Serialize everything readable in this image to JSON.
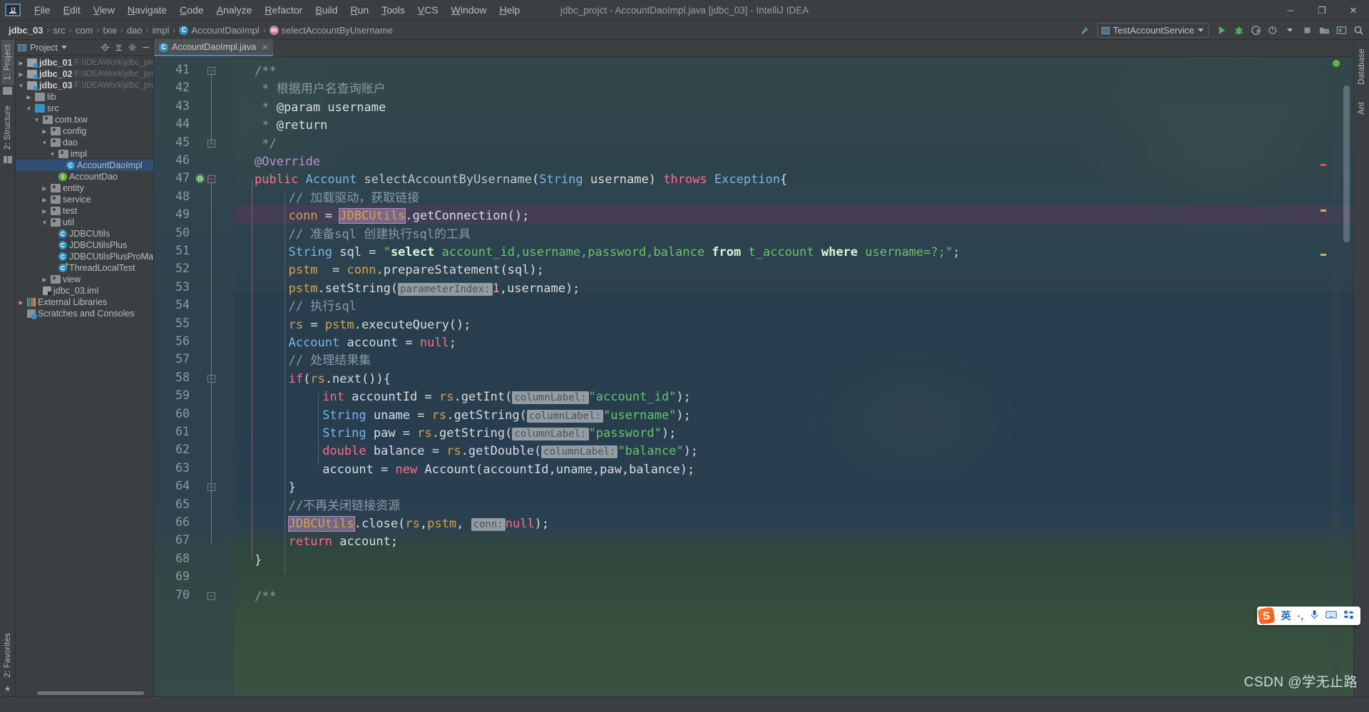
{
  "window": {
    "title": "jdbc_projct - AccountDaoImpl.java [jdbc_03] - IntelliJ IDEA",
    "minimize": "─",
    "maximize": "❐",
    "close": "✕"
  },
  "menu": [
    "File",
    "Edit",
    "View",
    "Navigate",
    "Code",
    "Analyze",
    "Refactor",
    "Build",
    "Run",
    "Tools",
    "VCS",
    "Window",
    "Help"
  ],
  "breadcrumbs": [
    {
      "label": "jdbc_03",
      "kind": "project"
    },
    {
      "label": "src",
      "kind": "folder"
    },
    {
      "label": "com",
      "kind": "folder"
    },
    {
      "label": "txw",
      "kind": "folder"
    },
    {
      "label": "dao",
      "kind": "folder"
    },
    {
      "label": "impl",
      "kind": "folder"
    },
    {
      "label": "AccountDaoImpl",
      "kind": "class"
    },
    {
      "label": "selectAccountByUsername",
      "kind": "method"
    }
  ],
  "toolbar": {
    "run_config": "TestAccountService",
    "icons": [
      "build-icon",
      "run-icon",
      "debug-icon",
      "run-coverage-icon",
      "profiler-icon",
      "stop-icon",
      "project-structure-icon",
      "terminal-icon",
      "search-everywhere-icon"
    ]
  },
  "left_strip": {
    "tabs": [
      "1: Project",
      "2: Structure"
    ],
    "bottom_tabs": [
      "2: Favorites"
    ]
  },
  "right_strip": {
    "tabs": [
      "Database",
      "Ant"
    ]
  },
  "project_panel": {
    "title": "Project",
    "actions": [
      "locate-icon",
      "collapse-all-icon",
      "settings-icon",
      "hide-icon"
    ],
    "tree": [
      {
        "indent": 0,
        "arrow": "collapsed",
        "icon": "module",
        "label": "jdbc_01",
        "bold": true,
        "path": "F:\\IDEAWork\\jdbc_projct\\j"
      },
      {
        "indent": 0,
        "arrow": "collapsed",
        "icon": "module",
        "label": "jdbc_02",
        "bold": true,
        "path": "F:\\IDEAWork\\jdbc_projct\\j"
      },
      {
        "indent": 0,
        "arrow": "expanded",
        "icon": "module",
        "label": "jdbc_03",
        "bold": true,
        "path": "F:\\IDEAWork\\jdbc_projct\\j"
      },
      {
        "indent": 1,
        "arrow": "collapsed",
        "icon": "dir",
        "label": "lib"
      },
      {
        "indent": 1,
        "arrow": "expanded",
        "icon": "src",
        "label": "src"
      },
      {
        "indent": 2,
        "arrow": "expanded",
        "icon": "pkg",
        "label": "com.txw"
      },
      {
        "indent": 3,
        "arrow": "collapsed",
        "icon": "pkg",
        "label": "config"
      },
      {
        "indent": 3,
        "arrow": "expanded",
        "icon": "pkg",
        "label": "dao"
      },
      {
        "indent": 4,
        "arrow": "expanded",
        "icon": "pkg",
        "label": "impl"
      },
      {
        "indent": 5,
        "arrow": "none",
        "icon": "class",
        "label": "AccountDaoImpl",
        "selected": true
      },
      {
        "indent": 4,
        "arrow": "none",
        "icon": "interface",
        "label": "AccountDao"
      },
      {
        "indent": 3,
        "arrow": "collapsed",
        "icon": "pkg",
        "label": "entity"
      },
      {
        "indent": 3,
        "arrow": "collapsed",
        "icon": "pkg",
        "label": "service"
      },
      {
        "indent": 3,
        "arrow": "collapsed",
        "icon": "pkg",
        "label": "test"
      },
      {
        "indent": 3,
        "arrow": "expanded",
        "icon": "pkg",
        "label": "util"
      },
      {
        "indent": 4,
        "arrow": "none",
        "icon": "class",
        "label": "JDBCUtils"
      },
      {
        "indent": 4,
        "arrow": "none",
        "icon": "class",
        "label": "JDBCUtilsPlus"
      },
      {
        "indent": 4,
        "arrow": "none",
        "icon": "class",
        "label": "JDBCUtilsPlusProMax"
      },
      {
        "indent": 4,
        "arrow": "none",
        "icon": "class-runnable",
        "label": "ThreadLocalTest"
      },
      {
        "indent": 3,
        "arrow": "collapsed",
        "icon": "pkg",
        "label": "view"
      },
      {
        "indent": 2,
        "arrow": "none",
        "icon": "iml",
        "label": "jdbc_03.iml"
      },
      {
        "indent": 0,
        "arrow": "collapsed",
        "icon": "libs",
        "label": "External Libraries"
      },
      {
        "indent": 0,
        "arrow": "none",
        "icon": "scratch",
        "label": "Scratches and Consoles"
      }
    ]
  },
  "editor": {
    "tab": {
      "label": "AccountDaoImpl.java",
      "icon": "java-class-icon",
      "close": "✕"
    },
    "first_line": 41,
    "lines": [
      {
        "n": 41,
        "indent": 0,
        "tokens": [
          {
            "t": "/**",
            "c": "cm"
          }
        ]
      },
      {
        "n": 42,
        "indent": 0,
        "tokens": [
          {
            "t": " * ",
            "c": "cm"
          },
          {
            "t": "根据用户名查询账户",
            "c": "cm"
          }
        ]
      },
      {
        "n": 43,
        "indent": 0,
        "tokens": [
          {
            "t": " * ",
            "c": "cm"
          },
          {
            "t": "@param username",
            "c": "txt"
          }
        ]
      },
      {
        "n": 44,
        "indent": 0,
        "tokens": [
          {
            "t": " * ",
            "c": "cm"
          },
          {
            "t": "@return",
            "c": "txt"
          }
        ]
      },
      {
        "n": 45,
        "indent": 0,
        "tokens": [
          {
            "t": " */",
            "c": "cm"
          }
        ]
      },
      {
        "n": 46,
        "indent": 0,
        "tokens": [
          {
            "t": "@Override",
            "c": "anno"
          }
        ]
      },
      {
        "n": 47,
        "indent": 0,
        "tokens": [
          {
            "t": "public ",
            "c": "kw2"
          },
          {
            "t": "Account ",
            "c": "cls"
          },
          {
            "t": "selectAccountByUsername",
            "c": "mth"
          },
          {
            "t": "(",
            "c": "txt"
          },
          {
            "t": "String ",
            "c": "cls"
          },
          {
            "t": "username",
            "c": "txt"
          },
          {
            "t": ") ",
            "c": "txt"
          },
          {
            "t": "throws ",
            "c": "kw2"
          },
          {
            "t": "Exception",
            "c": "cls"
          },
          {
            "t": "{",
            "c": "txt"
          }
        ]
      },
      {
        "n": 48,
        "indent": 1,
        "tokens": [
          {
            "t": "// 加载驱动，获取链接",
            "c": "cm"
          }
        ]
      },
      {
        "n": 49,
        "indent": 1,
        "highlight": true,
        "tokens": [
          {
            "t": "conn ",
            "c": "fld"
          },
          {
            "t": "= ",
            "c": "txt"
          },
          {
            "t": "JDBCUtils",
            "c": "fld",
            "hl": "ident"
          },
          {
            "t": ".getConnection();",
            "c": "txt"
          }
        ]
      },
      {
        "n": 50,
        "indent": 1,
        "tokens": [
          {
            "t": "// 准备sql 创建执行sql的工具",
            "c": "cm"
          }
        ]
      },
      {
        "n": 51,
        "indent": 1,
        "tokens": [
          {
            "t": "String ",
            "c": "cls"
          },
          {
            "t": "sql ",
            "c": "txt"
          },
          {
            "t": "= ",
            "c": "txt"
          },
          {
            "t": "\"",
            "c": "str"
          },
          {
            "t": "select",
            "c": "strkw"
          },
          {
            "t": " account_id,username,password,balance ",
            "c": "str"
          },
          {
            "t": "from",
            "c": "strkw"
          },
          {
            "t": " t_account ",
            "c": "str"
          },
          {
            "t": "where",
            "c": "strkw"
          },
          {
            "t": " username=?;\"",
            "c": "str"
          },
          {
            "t": ";",
            "c": "txt"
          }
        ]
      },
      {
        "n": 52,
        "indent": 1,
        "tokens": [
          {
            "t": "pstm ",
            "c": "fld"
          },
          {
            "t": " = ",
            "c": "txt"
          },
          {
            "t": "conn",
            "c": "fld"
          },
          {
            "t": ".prepareStatement(sql);",
            "c": "txt"
          }
        ]
      },
      {
        "n": 53,
        "indent": 1,
        "tokens": [
          {
            "t": "pstm",
            "c": "fld"
          },
          {
            "t": ".setString(",
            "c": "txt"
          },
          {
            "t": "parameterIndex:",
            "c": "hint"
          },
          {
            "t": "1",
            "c": "num"
          },
          {
            "t": ",username);",
            "c": "txt"
          }
        ]
      },
      {
        "n": 54,
        "indent": 1,
        "tokens": [
          {
            "t": "// 执行sql",
            "c": "cm"
          }
        ]
      },
      {
        "n": 55,
        "indent": 1,
        "tokens": [
          {
            "t": "rs ",
            "c": "fld"
          },
          {
            "t": "= ",
            "c": "txt"
          },
          {
            "t": "pstm",
            "c": "fld"
          },
          {
            "t": ".executeQuery();",
            "c": "txt"
          }
        ]
      },
      {
        "n": 56,
        "indent": 1,
        "tokens": [
          {
            "t": "Account ",
            "c": "cls"
          },
          {
            "t": "account = ",
            "c": "txt"
          },
          {
            "t": "null",
            "c": "kw2"
          },
          {
            "t": ";",
            "c": "txt"
          }
        ]
      },
      {
        "n": 57,
        "indent": 1,
        "tokens": [
          {
            "t": "// 处理结果集",
            "c": "cm"
          }
        ]
      },
      {
        "n": 58,
        "indent": 1,
        "tokens": [
          {
            "t": "if",
            "c": "kw2"
          },
          {
            "t": "(",
            "c": "txt"
          },
          {
            "t": "rs",
            "c": "fld"
          },
          {
            "t": ".next()){",
            "c": "txt"
          }
        ]
      },
      {
        "n": 59,
        "indent": 2,
        "tokens": [
          {
            "t": "int ",
            "c": "kw2"
          },
          {
            "t": "accountId = ",
            "c": "txt"
          },
          {
            "t": "rs",
            "c": "fld"
          },
          {
            "t": ".getInt(",
            "c": "txt"
          },
          {
            "t": "columnLabel:",
            "c": "hint"
          },
          {
            "t": "\"account_id\"",
            "c": "str"
          },
          {
            "t": ");",
            "c": "txt"
          }
        ]
      },
      {
        "n": 60,
        "indent": 2,
        "tokens": [
          {
            "t": "String ",
            "c": "cls"
          },
          {
            "t": "uname = ",
            "c": "txt"
          },
          {
            "t": "rs",
            "c": "fld"
          },
          {
            "t": ".getString(",
            "c": "txt"
          },
          {
            "t": "columnLabel:",
            "c": "hint"
          },
          {
            "t": "\"username\"",
            "c": "str"
          },
          {
            "t": ");",
            "c": "txt"
          }
        ]
      },
      {
        "n": 61,
        "indent": 2,
        "tokens": [
          {
            "t": "String ",
            "c": "cls"
          },
          {
            "t": "paw = ",
            "c": "txt"
          },
          {
            "t": "rs",
            "c": "fld"
          },
          {
            "t": ".getString(",
            "c": "txt"
          },
          {
            "t": "columnLabel:",
            "c": "hint"
          },
          {
            "t": "\"password\"",
            "c": "str"
          },
          {
            "t": ");",
            "c": "txt"
          }
        ]
      },
      {
        "n": 62,
        "indent": 2,
        "tokens": [
          {
            "t": "double ",
            "c": "kw2"
          },
          {
            "t": "balance = ",
            "c": "txt"
          },
          {
            "t": "rs",
            "c": "fld"
          },
          {
            "t": ".getDouble(",
            "c": "txt"
          },
          {
            "t": "columnLabel:",
            "c": "hint"
          },
          {
            "t": "\"balance\"",
            "c": "str"
          },
          {
            "t": ");",
            "c": "txt"
          }
        ]
      },
      {
        "n": 63,
        "indent": 2,
        "tokens": [
          {
            "t": "account = ",
            "c": "txt"
          },
          {
            "t": "new ",
            "c": "kw2"
          },
          {
            "t": "Account(accountId,uname,paw,balance);",
            "c": "txt"
          }
        ]
      },
      {
        "n": 64,
        "indent": 1,
        "tokens": [
          {
            "t": "}",
            "c": "txt"
          }
        ]
      },
      {
        "n": 65,
        "indent": 1,
        "tokens": [
          {
            "t": "//不再关闭链接资源",
            "c": "cm"
          }
        ]
      },
      {
        "n": 66,
        "indent": 1,
        "tokens": [
          {
            "t": "JDBCUtils",
            "c": "fld",
            "hl": "ident"
          },
          {
            "t": ".close(",
            "c": "txt"
          },
          {
            "t": "rs",
            "c": "fld"
          },
          {
            "t": ",",
            "c": "txt"
          },
          {
            "t": "pstm",
            "c": "fld"
          },
          {
            "t": ", ",
            "c": "txt"
          },
          {
            "t": "conn:",
            "c": "hint"
          },
          {
            "t": "null",
            "c": "kw2"
          },
          {
            "t": ");",
            "c": "txt"
          }
        ]
      },
      {
        "n": 67,
        "indent": 1,
        "tokens": [
          {
            "t": "return ",
            "c": "kw2"
          },
          {
            "t": "account;",
            "c": "txt"
          }
        ]
      },
      {
        "n": 68,
        "indent": 0,
        "tokens": [
          {
            "t": "}",
            "c": "txt"
          }
        ]
      },
      {
        "n": 69,
        "indent": 0,
        "tokens": []
      },
      {
        "n": 70,
        "indent": 0,
        "tokens": [
          {
            "t": "/**",
            "c": "cm"
          }
        ]
      }
    ]
  },
  "ime": {
    "logo": "S",
    "mode": "英",
    "punct": "·,",
    "mic": "mic-icon",
    "keyboard": "keyboard-icon",
    "apps": "apps-icon"
  },
  "watermark": "CSDN @学无止路",
  "colors": {
    "accent": "#4a88c7",
    "selection": "#2f4e72",
    "string": "#6ac46a",
    "keyword": "#ff6b8a",
    "class": "#7fb3e8",
    "field": "#d7a24c",
    "comment": "#8a9ba3",
    "annotation": "#bb8fd0"
  }
}
